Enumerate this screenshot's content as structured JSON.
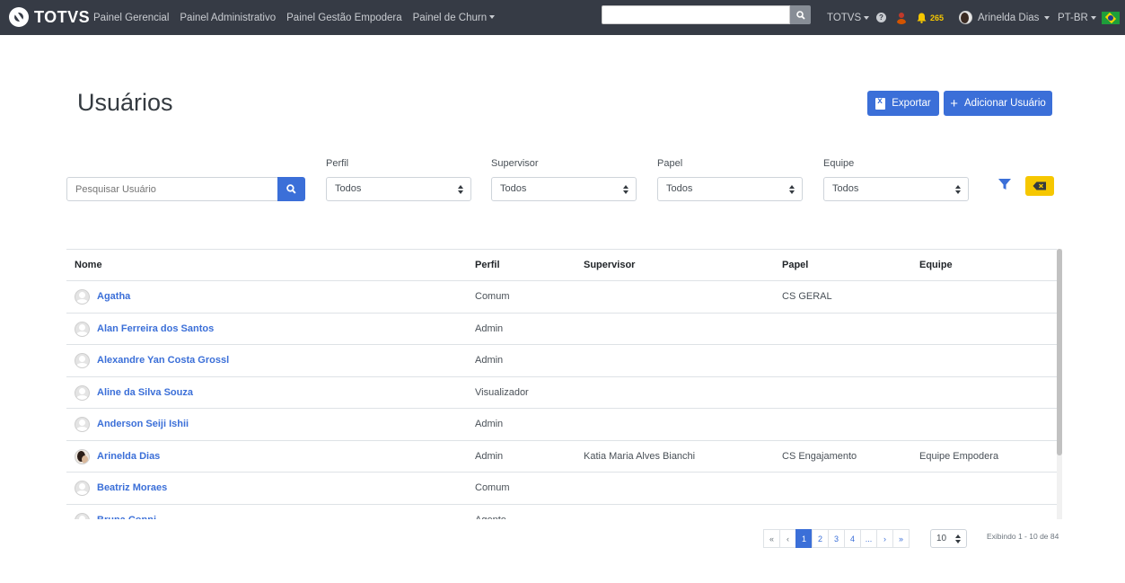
{
  "navbar": {
    "brand": "TOTVS",
    "links": [
      "Painel Gerencial",
      "Painel Administrativo",
      "Painel Gestão Empodera",
      "Painel de Churn"
    ],
    "search_value": "",
    "company_menu": "TOTVS",
    "help": "?",
    "notifications_count": "265",
    "user_name": "Arinelda Dias",
    "language": "PT-BR"
  },
  "page": {
    "title": "Usuários",
    "export_label": "Exportar",
    "add_user_label": "Adicionar Usuário"
  },
  "filters": {
    "search_placeholder": "Pesquisar Usuário",
    "perfil": {
      "label": "Perfil",
      "value": "Todos"
    },
    "supervisor": {
      "label": "Supervisor",
      "value": "Todos"
    },
    "papel": {
      "label": "Papel",
      "value": "Todos"
    },
    "equipe": {
      "label": "Equipe",
      "value": "Todos"
    }
  },
  "table": {
    "headers": {
      "nome": "Nome",
      "perfil": "Perfil",
      "supervisor": "Supervisor",
      "papel": "Papel",
      "equipe": "Equipe"
    },
    "rows": [
      {
        "nome": "Agatha",
        "perfil": "Comum",
        "supervisor": "",
        "papel": "CS GERAL",
        "equipe": "",
        "photo": false
      },
      {
        "nome": "Alan Ferreira dos Santos",
        "perfil": "Admin",
        "supervisor": "",
        "papel": "",
        "equipe": "",
        "photo": false
      },
      {
        "nome": "Alexandre Yan Costa Grossl",
        "perfil": "Admin",
        "supervisor": "",
        "papel": "",
        "equipe": "",
        "photo": false
      },
      {
        "nome": "Aline da Silva Souza",
        "perfil": "Visualizador",
        "supervisor": "",
        "papel": "",
        "equipe": "",
        "photo": false
      },
      {
        "nome": "Anderson Seiji Ishii",
        "perfil": "Admin",
        "supervisor": "",
        "papel": "",
        "equipe": "",
        "photo": false
      },
      {
        "nome": "Arinelda Dias",
        "perfil": "Admin",
        "supervisor": "Katia Maria Alves Bianchi",
        "papel": "CS Engajamento",
        "equipe": "Equipe Empodera",
        "photo": true
      },
      {
        "nome": "Beatriz Moraes",
        "perfil": "Comum",
        "supervisor": "",
        "papel": "",
        "equipe": "",
        "photo": false
      },
      {
        "nome": "Bruna Conni",
        "perfil": "Agente",
        "supervisor": "",
        "papel": "",
        "equipe": "",
        "photo": false
      }
    ]
  },
  "pagination": {
    "first": "«",
    "prev": "‹",
    "pages": [
      "1",
      "2",
      "3",
      "4",
      "..."
    ],
    "next": "›",
    "last": "»",
    "active_page": "1",
    "page_size": "10",
    "showing": "Exibindo 1 - 10 de 84"
  },
  "colors": {
    "navbar_bg": "#363b45",
    "primary": "#3b6fd8",
    "warning": "#f6c700"
  }
}
